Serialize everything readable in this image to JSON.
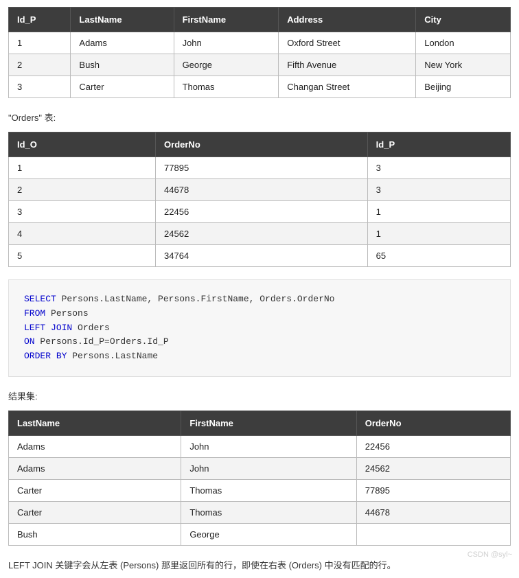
{
  "persons_table": {
    "headers": [
      "Id_P",
      "LastName",
      "FirstName",
      "Address",
      "City"
    ],
    "rows": [
      [
        "1",
        "Adams",
        "John",
        "Oxford Street",
        "London"
      ],
      [
        "2",
        "Bush",
        "George",
        "Fifth Avenue",
        "New York"
      ],
      [
        "3",
        "Carter",
        "Thomas",
        "Changan Street",
        "Beijing"
      ]
    ]
  },
  "orders_label": "\"Orders\" 表:",
  "orders_table": {
    "headers": [
      "Id_O",
      "OrderNo",
      "Id_P"
    ],
    "rows": [
      [
        "1",
        "77895",
        "3"
      ],
      [
        "2",
        "44678",
        "3"
      ],
      [
        "3",
        "22456",
        "1"
      ],
      [
        "4",
        "24562",
        "1"
      ],
      [
        "5",
        "34764",
        "65"
      ]
    ]
  },
  "sql": {
    "tokens": [
      {
        "t": "SELECT",
        "k": true
      },
      {
        "t": " Persons.LastName, Persons.FirstName, Orders.OrderNo\n"
      },
      {
        "t": "FROM",
        "k": true
      },
      {
        "t": " Persons\n"
      },
      {
        "t": "LEFT",
        "k": true
      },
      {
        "t": " "
      },
      {
        "t": "JOIN",
        "k": true
      },
      {
        "t": " Orders\n"
      },
      {
        "t": "ON",
        "k": true
      },
      {
        "t": " Persons.Id_P=Orders.Id_P\n"
      },
      {
        "t": "ORDER",
        "k": true
      },
      {
        "t": " "
      },
      {
        "t": "BY",
        "k": true
      },
      {
        "t": " Persons.LastName"
      }
    ]
  },
  "result_label": "结果集:",
  "result_table": {
    "headers": [
      "LastName",
      "FirstName",
      "OrderNo"
    ],
    "rows": [
      [
        "Adams",
        "John",
        "22456"
      ],
      [
        "Adams",
        "John",
        "24562"
      ],
      [
        "Carter",
        "Thomas",
        "77895"
      ],
      [
        "Carter",
        "Thomas",
        "44678"
      ],
      [
        "Bush",
        "George",
        ""
      ]
    ]
  },
  "footnote": "LEFT JOIN 关键字会从左表 (Persons) 那里返回所有的行，即使在右表 (Orders) 中没有匹配的行。",
  "watermark": "CSDN @syl~"
}
